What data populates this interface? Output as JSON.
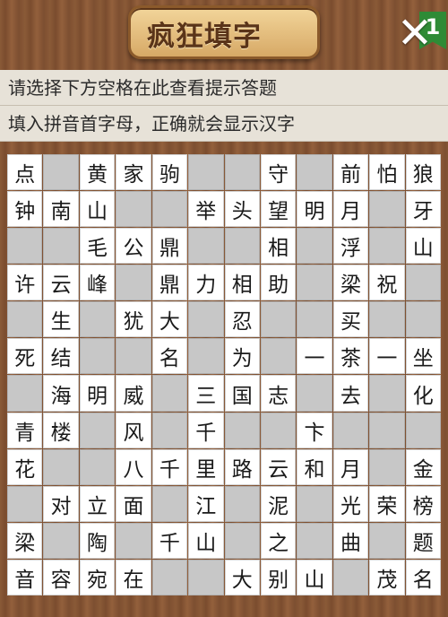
{
  "header": {
    "title": "疯狂填字",
    "level": "1",
    "close_label": "✕"
  },
  "hints": {
    "line1": "请选择下方空格在此查看提示答题",
    "line2": "填入拼音首字母，正确就会显示汉字"
  },
  "grid": [
    [
      {
        "t": "w",
        "c": "点"
      },
      {
        "t": "g",
        "c": ""
      },
      {
        "t": "w",
        "c": "黄"
      },
      {
        "t": "w",
        "c": "家"
      },
      {
        "t": "w",
        "c": "驹"
      },
      {
        "t": "g",
        "c": ""
      },
      {
        "t": "g",
        "c": ""
      },
      {
        "t": "w",
        "c": "守"
      },
      {
        "t": "g",
        "c": ""
      },
      {
        "t": "w",
        "c": "前"
      },
      {
        "t": "w",
        "c": "怕"
      },
      {
        "t": "w",
        "c": "狼"
      }
    ],
    [
      {
        "t": "w",
        "c": "钟"
      },
      {
        "t": "w",
        "c": "南"
      },
      {
        "t": "w",
        "c": "山"
      },
      {
        "t": "g",
        "c": ""
      },
      {
        "t": "g",
        "c": ""
      },
      {
        "t": "w",
        "c": "举"
      },
      {
        "t": "w",
        "c": "头"
      },
      {
        "t": "w",
        "c": "望"
      },
      {
        "t": "w",
        "c": "明"
      },
      {
        "t": "w",
        "c": "月"
      },
      {
        "t": "g",
        "c": ""
      },
      {
        "t": "w",
        "c": "牙"
      }
    ],
    [
      {
        "t": "g",
        "c": ""
      },
      {
        "t": "g",
        "c": ""
      },
      {
        "t": "w",
        "c": "毛"
      },
      {
        "t": "w",
        "c": "公"
      },
      {
        "t": "w",
        "c": "鼎"
      },
      {
        "t": "g",
        "c": ""
      },
      {
        "t": "g",
        "c": ""
      },
      {
        "t": "w",
        "c": "相"
      },
      {
        "t": "g",
        "c": ""
      },
      {
        "t": "w",
        "c": "浮"
      },
      {
        "t": "g",
        "c": ""
      },
      {
        "t": "w",
        "c": "山"
      }
    ],
    [
      {
        "t": "w",
        "c": "许"
      },
      {
        "t": "w",
        "c": "云"
      },
      {
        "t": "w",
        "c": "峰"
      },
      {
        "t": "g",
        "c": ""
      },
      {
        "t": "w",
        "c": "鼎"
      },
      {
        "t": "w",
        "c": "力"
      },
      {
        "t": "w",
        "c": "相"
      },
      {
        "t": "w",
        "c": "助"
      },
      {
        "t": "g",
        "c": ""
      },
      {
        "t": "w",
        "c": "梁"
      },
      {
        "t": "w",
        "c": "祝"
      },
      {
        "t": "g",
        "c": ""
      }
    ],
    [
      {
        "t": "g",
        "c": ""
      },
      {
        "t": "w",
        "c": "生"
      },
      {
        "t": "g",
        "c": ""
      },
      {
        "t": "w",
        "c": "犹"
      },
      {
        "t": "w",
        "c": "大"
      },
      {
        "t": "g",
        "c": ""
      },
      {
        "t": "w",
        "c": "忍"
      },
      {
        "t": "g",
        "c": ""
      },
      {
        "t": "g",
        "c": ""
      },
      {
        "t": "w",
        "c": "买"
      },
      {
        "t": "g",
        "c": ""
      },
      {
        "t": "g",
        "c": ""
      }
    ],
    [
      {
        "t": "w",
        "c": "死"
      },
      {
        "t": "w",
        "c": "结"
      },
      {
        "t": "g",
        "c": ""
      },
      {
        "t": "g",
        "c": ""
      },
      {
        "t": "w",
        "c": "名"
      },
      {
        "t": "g",
        "c": ""
      },
      {
        "t": "w",
        "c": "为"
      },
      {
        "t": "g",
        "c": ""
      },
      {
        "t": "w",
        "c": "一"
      },
      {
        "t": "w",
        "c": "茶"
      },
      {
        "t": "w",
        "c": "一"
      },
      {
        "t": "w",
        "c": "坐"
      }
    ],
    [
      {
        "t": "g",
        "c": ""
      },
      {
        "t": "w",
        "c": "海"
      },
      {
        "t": "w",
        "c": "明"
      },
      {
        "t": "w",
        "c": "威"
      },
      {
        "t": "g",
        "c": ""
      },
      {
        "t": "w",
        "c": "三"
      },
      {
        "t": "w",
        "c": "国"
      },
      {
        "t": "w",
        "c": "志"
      },
      {
        "t": "g",
        "c": ""
      },
      {
        "t": "w",
        "c": "去"
      },
      {
        "t": "g",
        "c": ""
      },
      {
        "t": "w",
        "c": "化"
      }
    ],
    [
      {
        "t": "w",
        "c": "青"
      },
      {
        "t": "w",
        "c": "楼"
      },
      {
        "t": "g",
        "c": ""
      },
      {
        "t": "w",
        "c": "风"
      },
      {
        "t": "g",
        "c": ""
      },
      {
        "t": "w",
        "c": "千"
      },
      {
        "t": "g",
        "c": ""
      },
      {
        "t": "g",
        "c": ""
      },
      {
        "t": "w",
        "c": "卞"
      },
      {
        "t": "g",
        "c": ""
      },
      {
        "t": "g",
        "c": ""
      },
      {
        "t": "g",
        "c": ""
      }
    ],
    [
      {
        "t": "w",
        "c": "花"
      },
      {
        "t": "g",
        "c": ""
      },
      {
        "t": "g",
        "c": ""
      },
      {
        "t": "w",
        "c": "八"
      },
      {
        "t": "w",
        "c": "千"
      },
      {
        "t": "w",
        "c": "里"
      },
      {
        "t": "w",
        "c": "路"
      },
      {
        "t": "w",
        "c": "云"
      },
      {
        "t": "w",
        "c": "和"
      },
      {
        "t": "w",
        "c": "月"
      },
      {
        "t": "g",
        "c": ""
      },
      {
        "t": "w",
        "c": "金"
      }
    ],
    [
      {
        "t": "g",
        "c": ""
      },
      {
        "t": "w",
        "c": "对"
      },
      {
        "t": "w",
        "c": "立"
      },
      {
        "t": "w",
        "c": "面"
      },
      {
        "t": "g",
        "c": ""
      },
      {
        "t": "w",
        "c": "江"
      },
      {
        "t": "g",
        "c": ""
      },
      {
        "t": "w",
        "c": "泥"
      },
      {
        "t": "g",
        "c": ""
      },
      {
        "t": "w",
        "c": "光"
      },
      {
        "t": "w",
        "c": "荣"
      },
      {
        "t": "w",
        "c": "榜"
      }
    ],
    [
      {
        "t": "w",
        "c": "梁"
      },
      {
        "t": "g",
        "c": ""
      },
      {
        "t": "w",
        "c": "陶"
      },
      {
        "t": "g",
        "c": ""
      },
      {
        "t": "w",
        "c": "千"
      },
      {
        "t": "w",
        "c": "山"
      },
      {
        "t": "g",
        "c": ""
      },
      {
        "t": "w",
        "c": "之"
      },
      {
        "t": "g",
        "c": ""
      },
      {
        "t": "w",
        "c": "曲"
      },
      {
        "t": "g",
        "c": ""
      },
      {
        "t": "w",
        "c": "题"
      }
    ],
    [
      {
        "t": "w",
        "c": "音"
      },
      {
        "t": "w",
        "c": "容"
      },
      {
        "t": "w",
        "c": "宛"
      },
      {
        "t": "w",
        "c": "在"
      },
      {
        "t": "g",
        "c": ""
      },
      {
        "t": "g",
        "c": ""
      },
      {
        "t": "w",
        "c": "大"
      },
      {
        "t": "w",
        "c": "别"
      },
      {
        "t": "w",
        "c": "山"
      },
      {
        "t": "g",
        "c": ""
      },
      {
        "t": "w",
        "c": "茂"
      },
      {
        "t": "w",
        "c": "名"
      }
    ]
  ]
}
